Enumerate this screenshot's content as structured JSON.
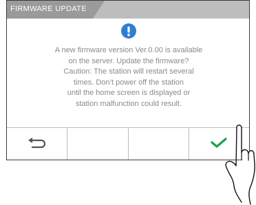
{
  "dialog": {
    "title": "FIRMWARE UPDATE",
    "icon": "exclamation-icon",
    "message_lines": [
      "A new firmware version Ver.0.00 is available",
      "on the server. Update the firmware?",
      "Caution: The station will restart several",
      "times. Don’t power off the station",
      "until the home screen is displayed or",
      "station malfunction could result."
    ]
  },
  "buttons": [
    {
      "name": "back",
      "icon": "back-arrow-icon"
    },
    {
      "name": "empty-2",
      "icon": ""
    },
    {
      "name": "empty-3",
      "icon": ""
    },
    {
      "name": "confirm",
      "icon": "checkmark-icon"
    }
  ],
  "colors": {
    "title_bar": "#bdbdbd",
    "title_tab": "#9a9a9a",
    "alert_icon": "#2e7fd0",
    "message_text": "#8a8a8a",
    "confirm_check": "#1aa34a"
  }
}
